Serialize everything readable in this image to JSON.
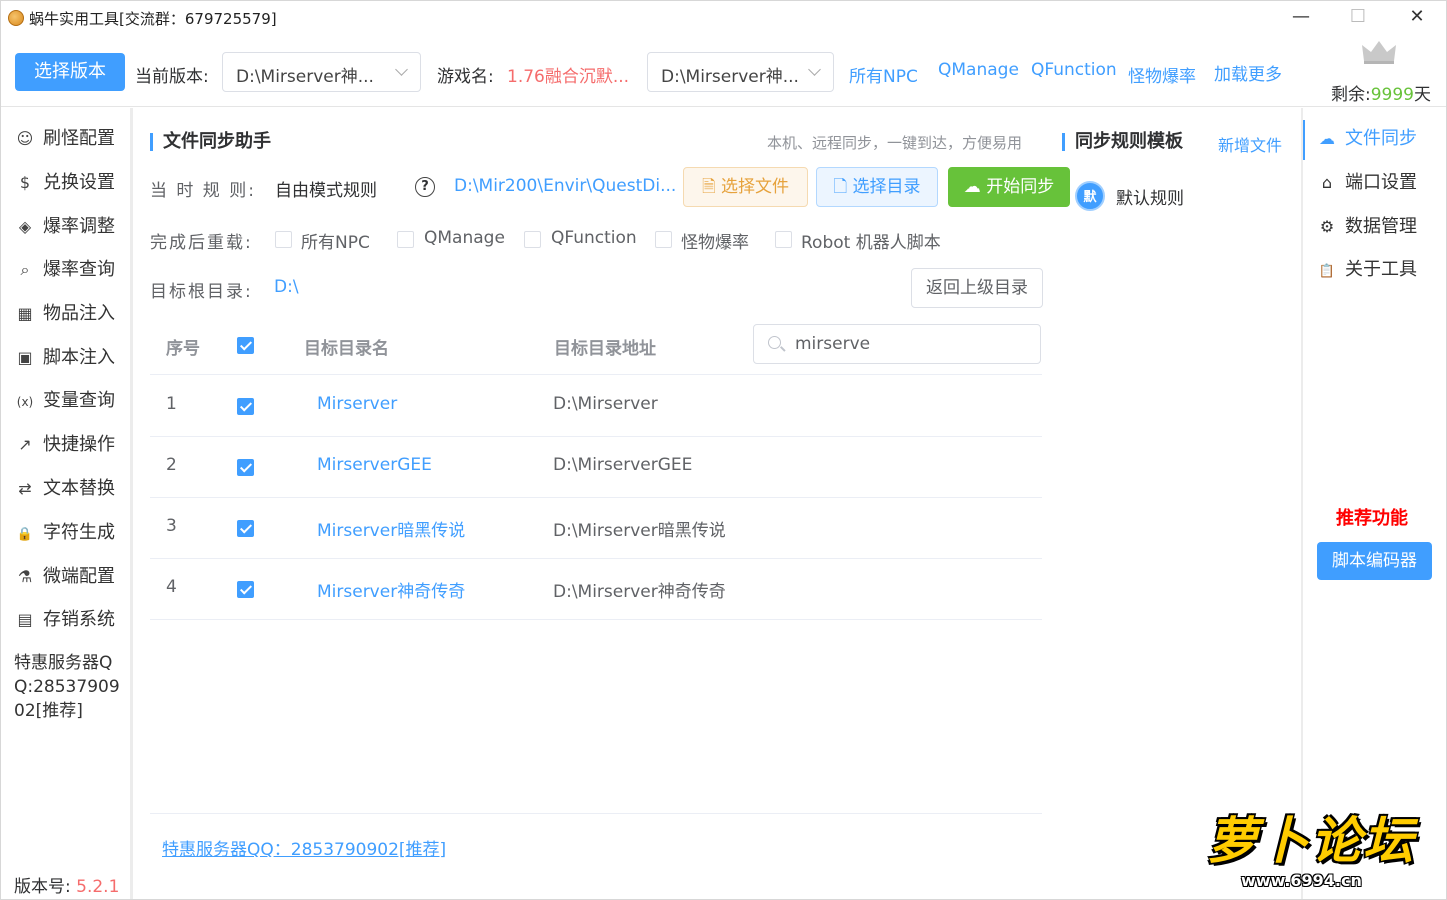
{
  "window": {
    "title": "蜗牛实用工具[交流群：679725579]",
    "minimize": "—",
    "maximize": "☐",
    "close": "✕"
  },
  "toolbar": {
    "select_version_label": "选择版本",
    "current_version_label": "当前版本:",
    "current_version_value": "D:\\Mirserver神...",
    "game_name_label": "游戏名:",
    "game_name_value": "1.76融合沉默...",
    "game_path_value": "D:\\Mirserver神...",
    "links": [
      "所有NPC",
      "QManage",
      "QFunction",
      "怪物爆率",
      "加载更多"
    ],
    "remain_prefix": "剩余:",
    "remain_value": "9999",
    "remain_suffix": "天"
  },
  "sidebar": {
    "items": [
      {
        "label": "刷怪配置",
        "icon": "robot-icon",
        "glyph": "☺"
      },
      {
        "label": "兑换设置",
        "icon": "dollar-icon",
        "glyph": "$"
      },
      {
        "label": "爆率调整",
        "icon": "box-icon",
        "glyph": "◈"
      },
      {
        "label": "爆率查询",
        "icon": "search-icon",
        "glyph": "⌕"
      },
      {
        "label": "物品注入",
        "icon": "grid-icon",
        "glyph": "▦"
      },
      {
        "label": "脚本注入",
        "icon": "terminal-icon",
        "glyph": "▣"
      },
      {
        "label": "变量查询",
        "icon": "variable-icon",
        "glyph": "(x)"
      },
      {
        "label": "快捷操作",
        "icon": "external-link-icon",
        "glyph": "↗"
      },
      {
        "label": "文本替换",
        "icon": "replace-icon",
        "glyph": "⇄"
      },
      {
        "label": "字符生成",
        "icon": "lock-icon",
        "glyph": "🔒"
      },
      {
        "label": "微端配置",
        "icon": "microscope-icon",
        "glyph": "⚗"
      },
      {
        "label": "存销系统",
        "icon": "store-icon",
        "glyph": "▤"
      }
    ],
    "promo": "特惠服务器QQ:2853790902[推荐]",
    "version_label": "版本号:",
    "version_value": "5.2.1"
  },
  "main": {
    "section_title": "文件同步助手",
    "section_desc": "本机、远程同步，一键到达，方便易用",
    "template_title": "同步规则模板",
    "add_file_link": "新增文件",
    "rule_label": "当 时 规 则:",
    "rule_value": "自由模式规则",
    "help_glyph": "?",
    "rule_path": "D:\\Mir200\\Envir\\QuestDi...",
    "btn_select_file": "选择文件",
    "btn_select_dir": "选择目录",
    "btn_start_sync": "开始同步",
    "default_badge": "默",
    "default_rule": "默认规则",
    "reload_label": "完成后重载:",
    "reload_options": [
      {
        "label": "所有NPC",
        "checked": false
      },
      {
        "label": "QManage",
        "checked": false
      },
      {
        "label": "QFunction",
        "checked": false
      },
      {
        "label": "怪物爆率",
        "checked": false
      },
      {
        "label": "Robot 机器人脚本",
        "checked": false
      }
    ],
    "target_root_label": "目标根目录:",
    "target_root_value": "D:\\",
    "btn_parent_dir": "返回上级目录",
    "table": {
      "headers": [
        "序号",
        "目标目录名",
        "目标目录地址"
      ],
      "search_value": "mirserve",
      "rows": [
        {
          "no": "1",
          "checked": true,
          "name": "Mirserver",
          "path": "D:\\Mirserver"
        },
        {
          "no": "2",
          "checked": true,
          "name": "MirserverGEE",
          "path": "D:\\MirserverGEE"
        },
        {
          "no": "3",
          "checked": true,
          "name": "Mirserver暗黑传说",
          "path": "D:\\Mirserver暗黑传说"
        },
        {
          "no": "4",
          "checked": true,
          "name": "Mirserver神奇传奇",
          "path": "D:\\Mirserver神奇传奇"
        }
      ]
    },
    "footer_link": "特惠服务器QQ：2853790902[推荐]"
  },
  "right_nav": {
    "items": [
      {
        "label": "文件同步",
        "icon": "cloud-upload-icon",
        "glyph": "☁",
        "active": true
      },
      {
        "label": "端口设置",
        "icon": "port-icon",
        "glyph": "⌂",
        "active": false
      },
      {
        "label": "数据管理",
        "icon": "gear-icon",
        "glyph": "⚙",
        "active": false
      },
      {
        "label": "关于工具",
        "icon": "clipboard-icon",
        "glyph": "📋",
        "active": false
      }
    ],
    "recommend_label": "推荐功能",
    "encoder_button": "脚本编码器"
  },
  "site_logo": {
    "text": "萝卜论坛",
    "url": "www.6994.cn"
  },
  "colors": {
    "primary": "#409eff",
    "success": "#67c23a",
    "warning": "#e6a23c",
    "danger": "#f56c6c",
    "recommend": "#ff0000"
  }
}
